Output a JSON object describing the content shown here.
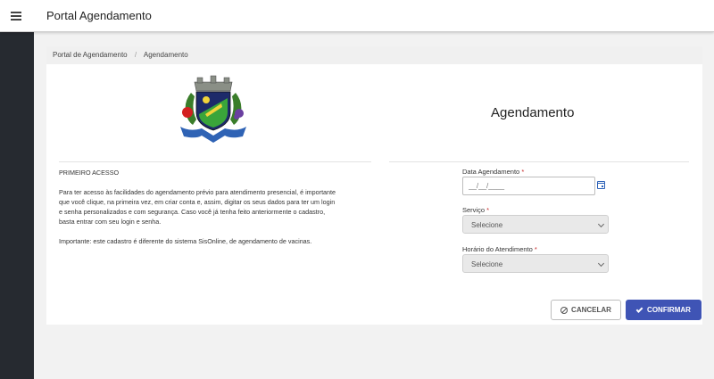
{
  "header": {
    "title": "Portal Agendamento",
    "menu_icon": "menu-icon"
  },
  "breadcrumb": {
    "items": [
      "Portal de Agendamento",
      "Agendamento"
    ],
    "separator": "/"
  },
  "page": {
    "title": "Agendamento",
    "crest_icon": "municipal-coat-of-arms"
  },
  "info": {
    "heading": "PRIMEIRO ACESSO",
    "paragraph_line1": "Para ter acesso às facilidades do agendamento prévio para atendimento presencial, é importante",
    "paragraph_line2": "que você clique, na primeira vez, em criar conta e, assim, digitar os seus dados para ter um login",
    "paragraph_line3": "e senha personalizados e com segurança. Caso você já tenha feito anteriormente o cadastro,",
    "paragraph_line4": "basta entrar com seu login e senha.",
    "note": "Importante: este cadastro é diferente do sistema SisOnline, de  agendamento de vacinas."
  },
  "form": {
    "date": {
      "label": "Data Agendamento",
      "required_mark": "*",
      "placeholder": "__/__/____",
      "icon": "calendar-icon"
    },
    "service": {
      "label": "Serviço",
      "required_mark": "*",
      "value": "Selecione"
    },
    "time": {
      "label": "Horário do Atendimento",
      "required_mark": "*",
      "value": "Selecione"
    }
  },
  "actions": {
    "cancel_label": "CANCELAR",
    "confirm_label": "CONFIRMAR"
  },
  "colors": {
    "primary": "#3f54b5",
    "sidebar": "#262a30",
    "required": "#c62828"
  }
}
